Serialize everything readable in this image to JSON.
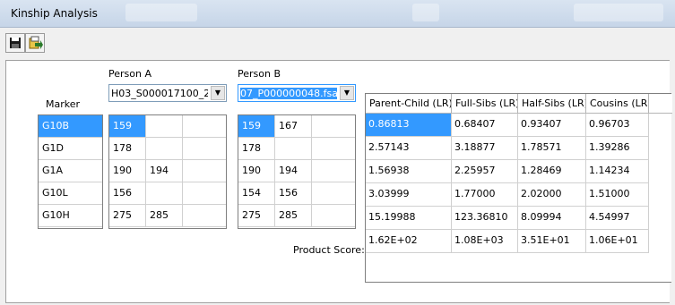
{
  "window": {
    "title": "Kinship Analysis"
  },
  "toolbar": {
    "save_icon": "floppy-disk-icon",
    "export_icon": "export-icon"
  },
  "labels": {
    "marker": "Marker",
    "person_a": "Person A",
    "person_b": "Person B",
    "product_score": "Product Score:"
  },
  "person_a": {
    "selected_file": "H03_S000017100_2"
  },
  "person_b": {
    "selected_file": "07_P000000048.fsa"
  },
  "markers": [
    "G10B",
    "G1D",
    "G1A",
    "G10L",
    "G10H"
  ],
  "person_a_alleles": [
    [
      "159",
      ""
    ],
    [
      "178",
      ""
    ],
    [
      "190",
      "194"
    ],
    [
      "156",
      ""
    ],
    [
      "275",
      "285"
    ]
  ],
  "person_b_alleles": [
    [
      "159",
      "167"
    ],
    [
      "178",
      ""
    ],
    [
      "190",
      "194"
    ],
    [
      "154",
      "156"
    ],
    [
      "275",
      "285"
    ]
  ],
  "results": {
    "columns": [
      "Parent-Child (LR)",
      "Full-Sibs (LR)",
      "Half-Sibs (LR)",
      "Cousins (LR)"
    ],
    "rows": [
      [
        "0.86813",
        "0.68407",
        "0.93407",
        "0.96703"
      ],
      [
        "2.57143",
        "3.18877",
        "1.78571",
        "1.39286"
      ],
      [
        "1.56938",
        "2.25957",
        "1.28469",
        "1.14234"
      ],
      [
        "3.03999",
        "1.77000",
        "2.02000",
        "1.51000"
      ],
      [
        "15.19988",
        "123.36810",
        "8.09994",
        "4.54997"
      ]
    ],
    "product_scores": [
      "1.62E+02",
      "1.08E+03",
      "3.51E+01",
      "1.06E+01"
    ]
  },
  "colors": {
    "selection": "#3399ff",
    "titlebar": "#c6d5e8"
  }
}
